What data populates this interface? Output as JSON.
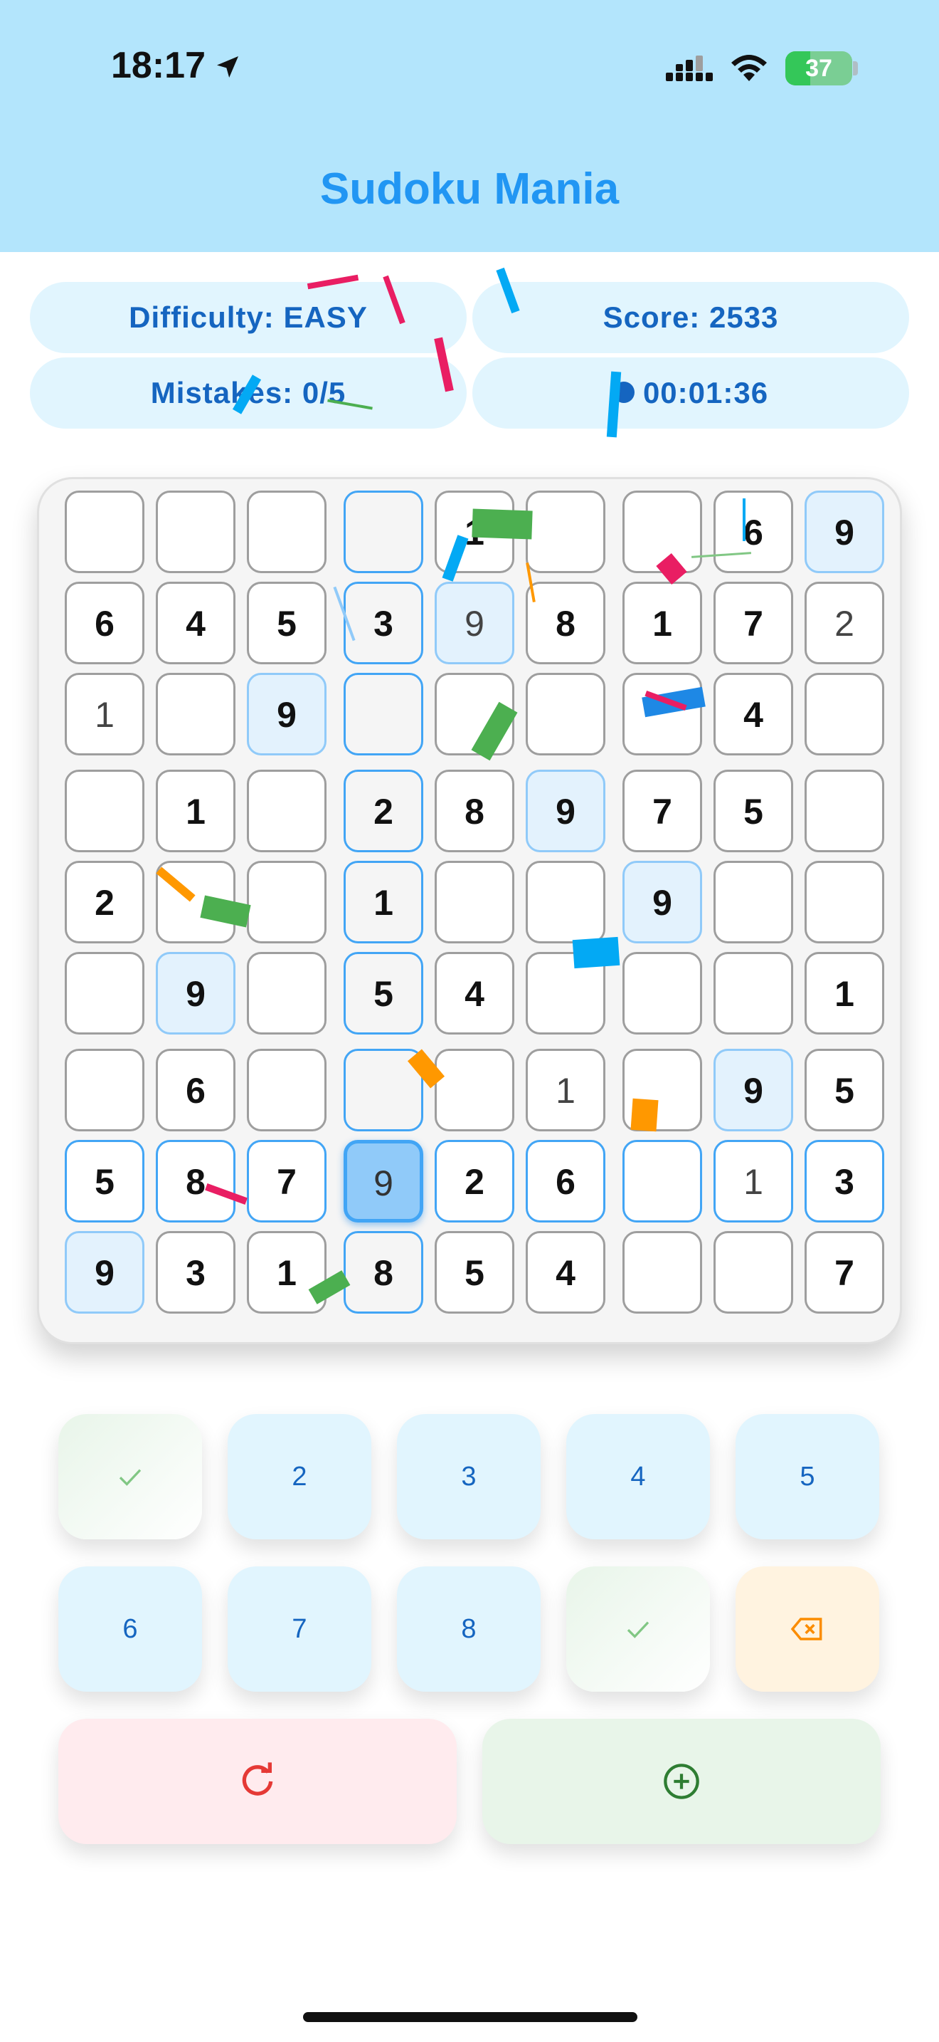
{
  "status_bar": {
    "time": "18:17",
    "battery": "37",
    "battery_level": 0.37
  },
  "app": {
    "title": "Sudoku Mania"
  },
  "info": {
    "difficulty": "Difficulty: EASY",
    "score": "Score: 2533",
    "mistakes": "Mistakes: 0/5",
    "timer": "00:01:36"
  },
  "board": {
    "rows": [
      [
        "",
        "",
        "",
        "",
        "1",
        "",
        "",
        "6",
        "9"
      ],
      [
        "6",
        "4",
        "5",
        "3",
        "9",
        "8",
        "1",
        "7",
        "2"
      ],
      [
        "1",
        "",
        "9",
        "",
        "",
        "",
        "",
        "4",
        ""
      ],
      [
        "",
        "1",
        "",
        "2",
        "8",
        "9",
        "7",
        "5",
        ""
      ],
      [
        "2",
        "",
        "",
        "1",
        "",
        "",
        "9",
        "",
        ""
      ],
      [
        "",
        "9",
        "",
        "5",
        "4",
        "",
        "",
        "",
        "1"
      ],
      [
        "",
        "6",
        "",
        "",
        "",
        "1",
        "",
        "9",
        "5"
      ],
      [
        "5",
        "8",
        "7",
        "9",
        "2",
        "6",
        "",
        "1",
        "3"
      ],
      [
        "9",
        "3",
        "1",
        "8",
        "5",
        "4",
        "",
        "",
        "7"
      ]
    ]
  },
  "keypad": {
    "row1": [
      "✓",
      "2",
      "3",
      "4",
      "5"
    ],
    "row2": [
      "6",
      "7",
      "8",
      "✓",
      "⌫"
    ],
    "icons": {
      "done": "check-icon",
      "erase": "backspace-icon",
      "reset": "refresh-icon",
      "add": "add-circle-icon"
    }
  },
  "colors": {
    "header_bg": "#b3e5fc",
    "accent": "#2196f3",
    "pill_bg": "#e1f5fe",
    "pill_text": "#1565c0",
    "selected_cell": "#90caf9",
    "reset_bg": "#ffebee",
    "add_bg": "#e8f5e9",
    "erase_bg": "#fff3e0"
  }
}
